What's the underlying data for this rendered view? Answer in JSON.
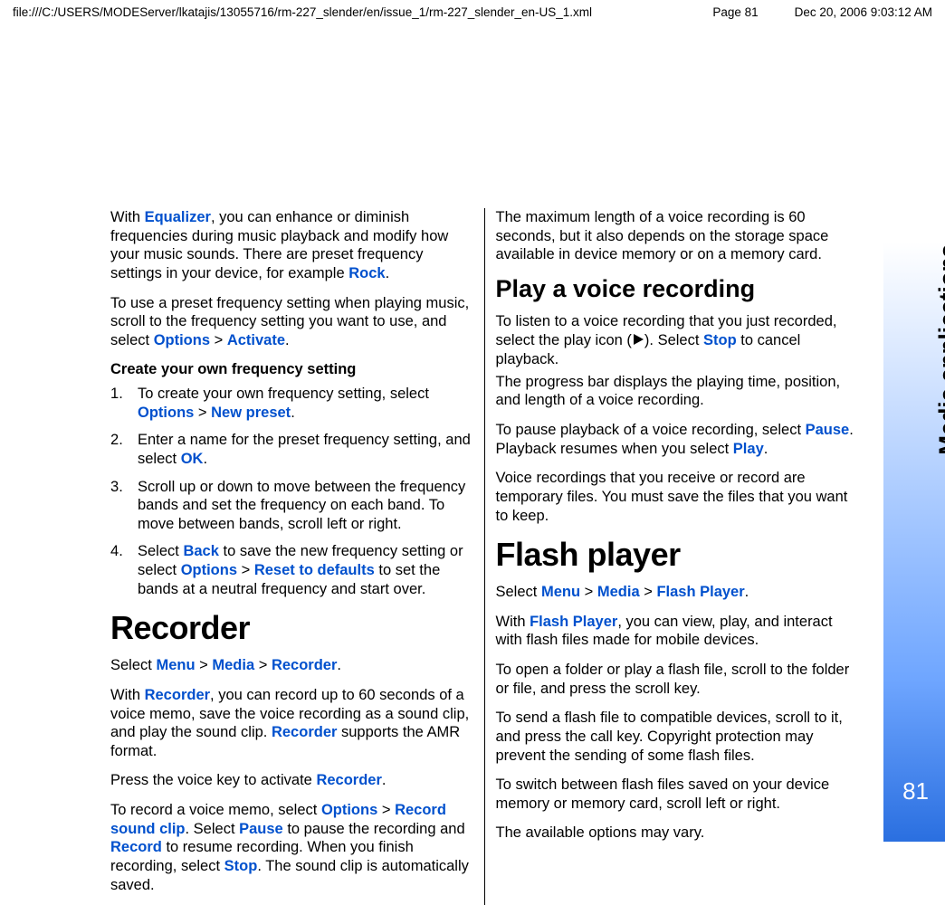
{
  "header": {
    "path": "file:///C:/USERS/MODEServer/lkatajis/13055716/rm-227_slender/en/issue_1/rm-227_slender_en-US_1.xml",
    "page": "Page 81",
    "date": "Dec 20, 2006 9:03:12 AM"
  },
  "sidebar": {
    "section": "Media applications",
    "page_number": "81"
  },
  "column1": {
    "equalizer": {
      "p1a": "With ",
      "k1": "Equalizer",
      "p1b": ", you can enhance or diminish frequencies during music playback and modify how your music sounds. There are preset frequency settings in your device, for example ",
      "k2": "Rock",
      "p1c": ".",
      "p2a": "To use a preset frequency setting when playing music, scroll to the frequency setting you want to use, and select ",
      "k3": "Options",
      "gt": " > ",
      "k4": "Activate",
      "p2b": ".",
      "subhead": "Create your own frequency setting",
      "li1a": "To create your own frequency setting, select ",
      "li1k1": "Options",
      "li1k2": "New preset",
      "li1b": ".",
      "li2a": "Enter a name for the preset frequency setting, and select ",
      "li2k1": "OK",
      "li2b": ".",
      "li3": "Scroll up or down to move between the frequency bands and set the frequency on each band. To move between bands, scroll left or right.",
      "li4a": "Select ",
      "li4k1": "Back",
      "li4b": " to save the new frequency setting or select ",
      "li4k2": "Options",
      "li4k3": "Reset to defaults",
      "li4c": " to set the bands at a neutral frequency and start over."
    },
    "recorder": {
      "title": "Recorder",
      "nav_a": "Select ",
      "nav_k1": "Menu",
      "nav_k2": "Media",
      "nav_k3": "Recorder",
      "nav_b": ".",
      "p1a": "With ",
      "p1k1": "Recorder",
      "p1b": ", you can record up to 60 seconds of a voice memo, save the voice recording as a sound clip, and play the sound clip. ",
      "p1k2": "Recorder",
      "p1c": " supports the AMR format.",
      "p2a": "Press the voice key to activate ",
      "p2k1": "Recorder",
      "p2b": ".",
      "p3a": "To record a voice memo, select ",
      "p3k1": "Options",
      "p3k2": "Record sound clip",
      "p3b": ". Select ",
      "p3k3": "Pause",
      "p3c": " to pause the recording and ",
      "p3k4": "Record",
      "p3d": " to resume recording. When you finish recording, select ",
      "p3k5": "Stop",
      "p3e": ". The sound clip is automatically saved."
    }
  },
  "column2": {
    "maxlen": "The maximum length of a voice recording is 60 seconds, but it also depends on the storage space available in device memory or on a memory card.",
    "play": {
      "title": "Play a voice recording",
      "p1a": "To listen to a voice recording that you just recorded, select the play icon (",
      "p1b": "). Select ",
      "p1k1": "Stop",
      "p1c": " to cancel playback.",
      "p2": "The progress bar displays the playing time, position, and length of a voice recording.",
      "p3a": "To pause playback of a voice recording, select ",
      "p3k1": "Pause",
      "p3b": ". Playback resumes when you select ",
      "p3k2": "Play",
      "p3c": ".",
      "p4": "Voice recordings that you receive or record are temporary files. You must save the files that you want to keep."
    },
    "flash": {
      "title": "Flash player",
      "nav_a": "Select ",
      "nav_k1": "Menu",
      "nav_k2": "Media",
      "nav_k3": "Flash Player",
      "nav_b": ".",
      "p1a": "With ",
      "p1k1": "Flash Player",
      "p1b": ", you can view, play, and interact with flash files made for mobile devices.",
      "p2": "To open a folder or play a flash file, scroll to the folder or file, and press the scroll key.",
      "p3": "To send a flash file to compatible devices, scroll to it, and press the call key. Copyright protection may prevent the sending of some flash files.",
      "p4": "To switch between flash files saved on your device memory or memory card, scroll left or right.",
      "p5": "The available options may vary."
    }
  }
}
